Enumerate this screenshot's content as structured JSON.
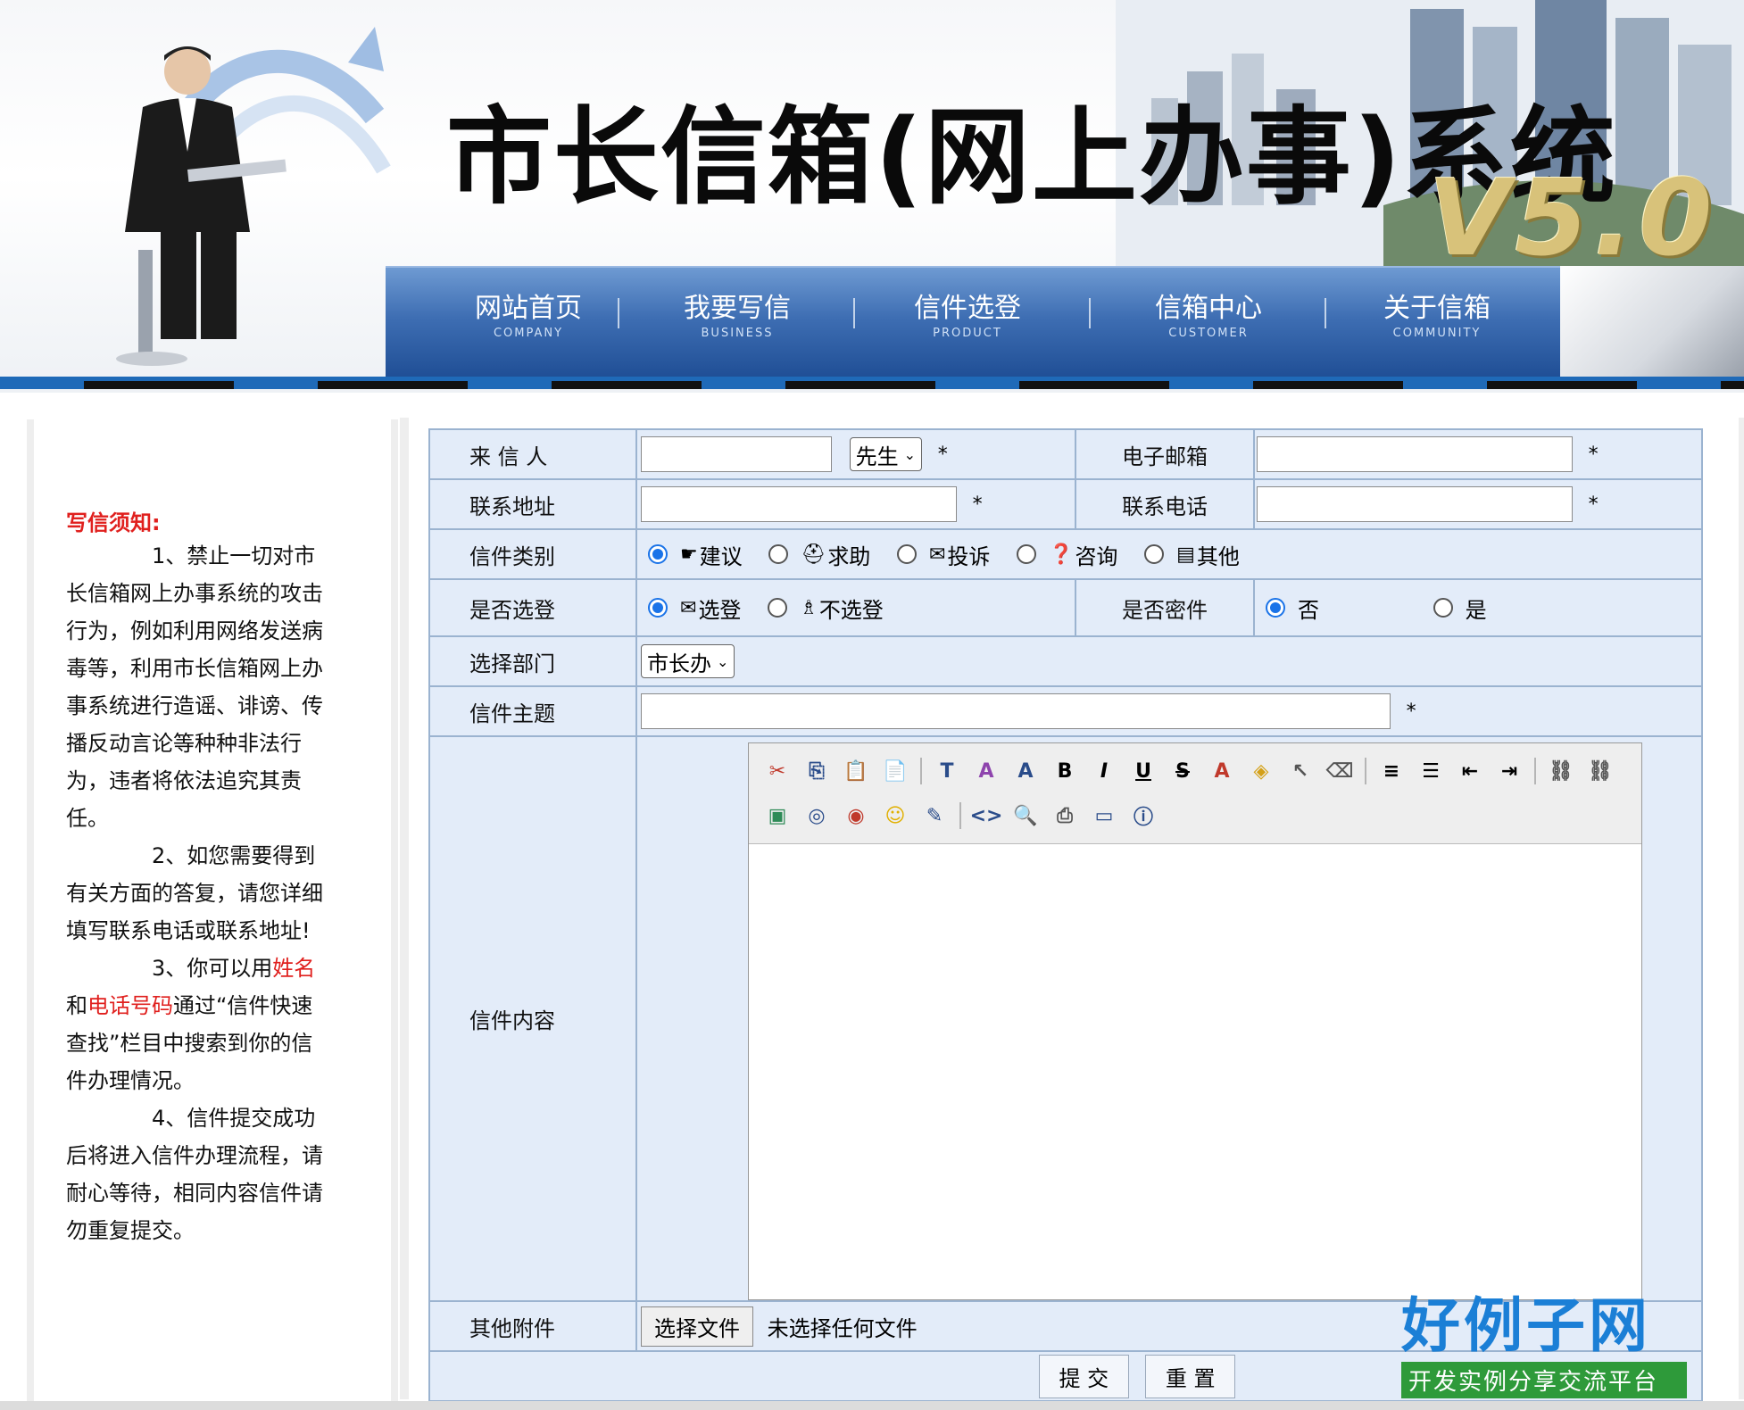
{
  "header": {
    "site_title": "市长信箱(网上办事)系统",
    "version": "V5.0"
  },
  "nav": [
    {
      "zh": "网站首页",
      "en": "COMPANY"
    },
    {
      "zh": "我要写信",
      "en": "BUSINESS"
    },
    {
      "zh": "信件选登",
      "en": "PRODUCT"
    },
    {
      "zh": "信箱中心",
      "en": "CUSTOMER"
    },
    {
      "zh": "关于信箱",
      "en": "COMMUNITY"
    }
  ],
  "sidebar": {
    "notice_title": "写信须知:",
    "item1": "1、禁止一切对市长信箱网上办事系统的攻击行为，例如利用网络发送病毒等，利用市长信箱网上办事系统进行造谣、诽谤、传播反动言论等种种非法行为，违者将依法追究其责任。",
    "item2": "2、如您需要得到有关方面的答复，请您详细填写联系电话或联系地址!",
    "item3_a": "3、你可以用",
    "item3_name": "姓名",
    "item3_b": "和",
    "item3_phone": "电话号码",
    "item3_c": "通过“信件快速查找”栏目中搜索到你的信件办理情况。",
    "item4": "4、信件提交成功后将进入信件办理流程，请耐心等待，相同内容信件请勿重复提交。"
  },
  "form": {
    "sender_label": "来 信 人",
    "sender_value": "",
    "title_select": "先生",
    "email_label": "电子邮箱",
    "email_value": "",
    "address_label": "联系地址",
    "address_value": "",
    "phone_label": "联系电话",
    "phone_value": "",
    "required_mark": "*",
    "category_label": "信件类别",
    "categories": [
      "建议",
      "求助",
      "投诉",
      "咨询",
      "其他"
    ],
    "category_selected": "建议",
    "publish_label": "是否选登",
    "publish_options": [
      "选登",
      "不选登"
    ],
    "publish_selected": "选登",
    "secret_label": "是否密件",
    "secret_options": [
      "否",
      "是"
    ],
    "secret_selected": "否",
    "dept_label": "选择部门",
    "dept_select": "市长办",
    "subject_label": "信件主题",
    "subject_value": "",
    "content_label": "信件内容",
    "attach_label": "其他附件",
    "file_button": "选择文件",
    "file_status": "未选择任何文件",
    "submit": "提 交",
    "reset": "重 置"
  },
  "editor_toolbar": {
    "row1": [
      "cut-icon",
      "copy-icon",
      "paste-icon",
      "paste-text-icon",
      "font-size-icon",
      "font-face-icon",
      "font-style-icon",
      "bold-icon",
      "italic-icon",
      "underline-icon",
      "strikethrough-icon",
      "font-color-icon",
      "bg-color-icon",
      "select-icon",
      "eraser-icon",
      "align-left-icon",
      "ordered-list-icon",
      "outdent-icon",
      "indent-icon",
      "link-icon",
      "unlink-icon"
    ],
    "row2": [
      "image-icon",
      "flash-icon",
      "media-icon",
      "emoticon-icon",
      "form-icon",
      "source-icon",
      "preview-icon",
      "print-icon",
      "fullscreen-icon",
      "about-icon"
    ]
  },
  "watermark": {
    "big": "好例子网",
    "small": "开发实例分享交流平台"
  },
  "colors": {
    "nav_blue": "#3e6eb3",
    "notice_red": "#e0201e",
    "form_bg": "#e3ecf9",
    "radio_blue": "#1a73e8"
  }
}
